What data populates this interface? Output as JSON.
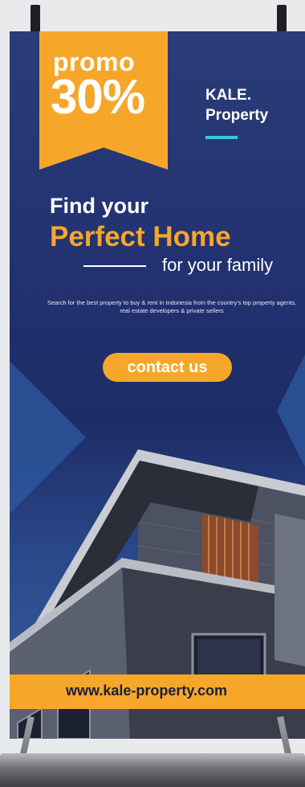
{
  "promo": {
    "word": "promo",
    "percent": "30%"
  },
  "brand": {
    "line1": "KALE.",
    "line2": "Property"
  },
  "headline": {
    "line1": "Find your",
    "line2": "Perfect Home",
    "line3": "for your family"
  },
  "description": "Search for the best property to buy & rent in Indonesia from the country's top property agents, real estate developers & private sellers",
  "cta": {
    "label": "contact us"
  },
  "website": "www.kale-property.com",
  "colors": {
    "accent": "#f6a72a",
    "navy": "#1e2c66",
    "brand_bar": "#3ec1e6"
  }
}
